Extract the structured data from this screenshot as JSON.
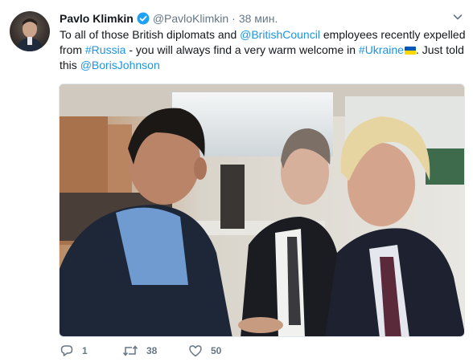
{
  "user": {
    "name": "Pavlo Klimkin",
    "handle": "@PavloKlimkin",
    "separator": "·",
    "time": "38 мин."
  },
  "tweet": {
    "text_parts": [
      {
        "t": "To all of those British diplomats and ",
        "link": false
      },
      {
        "t": "@BritishCouncil",
        "link": true
      },
      {
        "t": " employees recently expelled from ",
        "link": false
      },
      {
        "t": "#Russia",
        "link": true
      },
      {
        "t": " - you will always find a very warm welcome in ",
        "link": false
      },
      {
        "t": "#Ukraine",
        "link": true
      },
      {
        "t": ". Just told this ",
        "link": false
      },
      {
        "t": "@BorisJohnson",
        "link": true
      }
    ]
  },
  "actions": {
    "replies": "1",
    "retweets": "38",
    "likes": "50"
  },
  "colors": {
    "link": "#1b95e0",
    "verified": "#1da1f2",
    "meta": "#657786",
    "flag_blue": "#0057b7",
    "flag_yellow": "#ffd700"
  },
  "icons": {
    "verified": "verified-badge-icon",
    "caret": "chevron-down-icon",
    "reply": "reply-icon",
    "retweet": "retweet-icon",
    "like": "heart-icon",
    "flag": "ukraine-flag-icon"
  }
}
